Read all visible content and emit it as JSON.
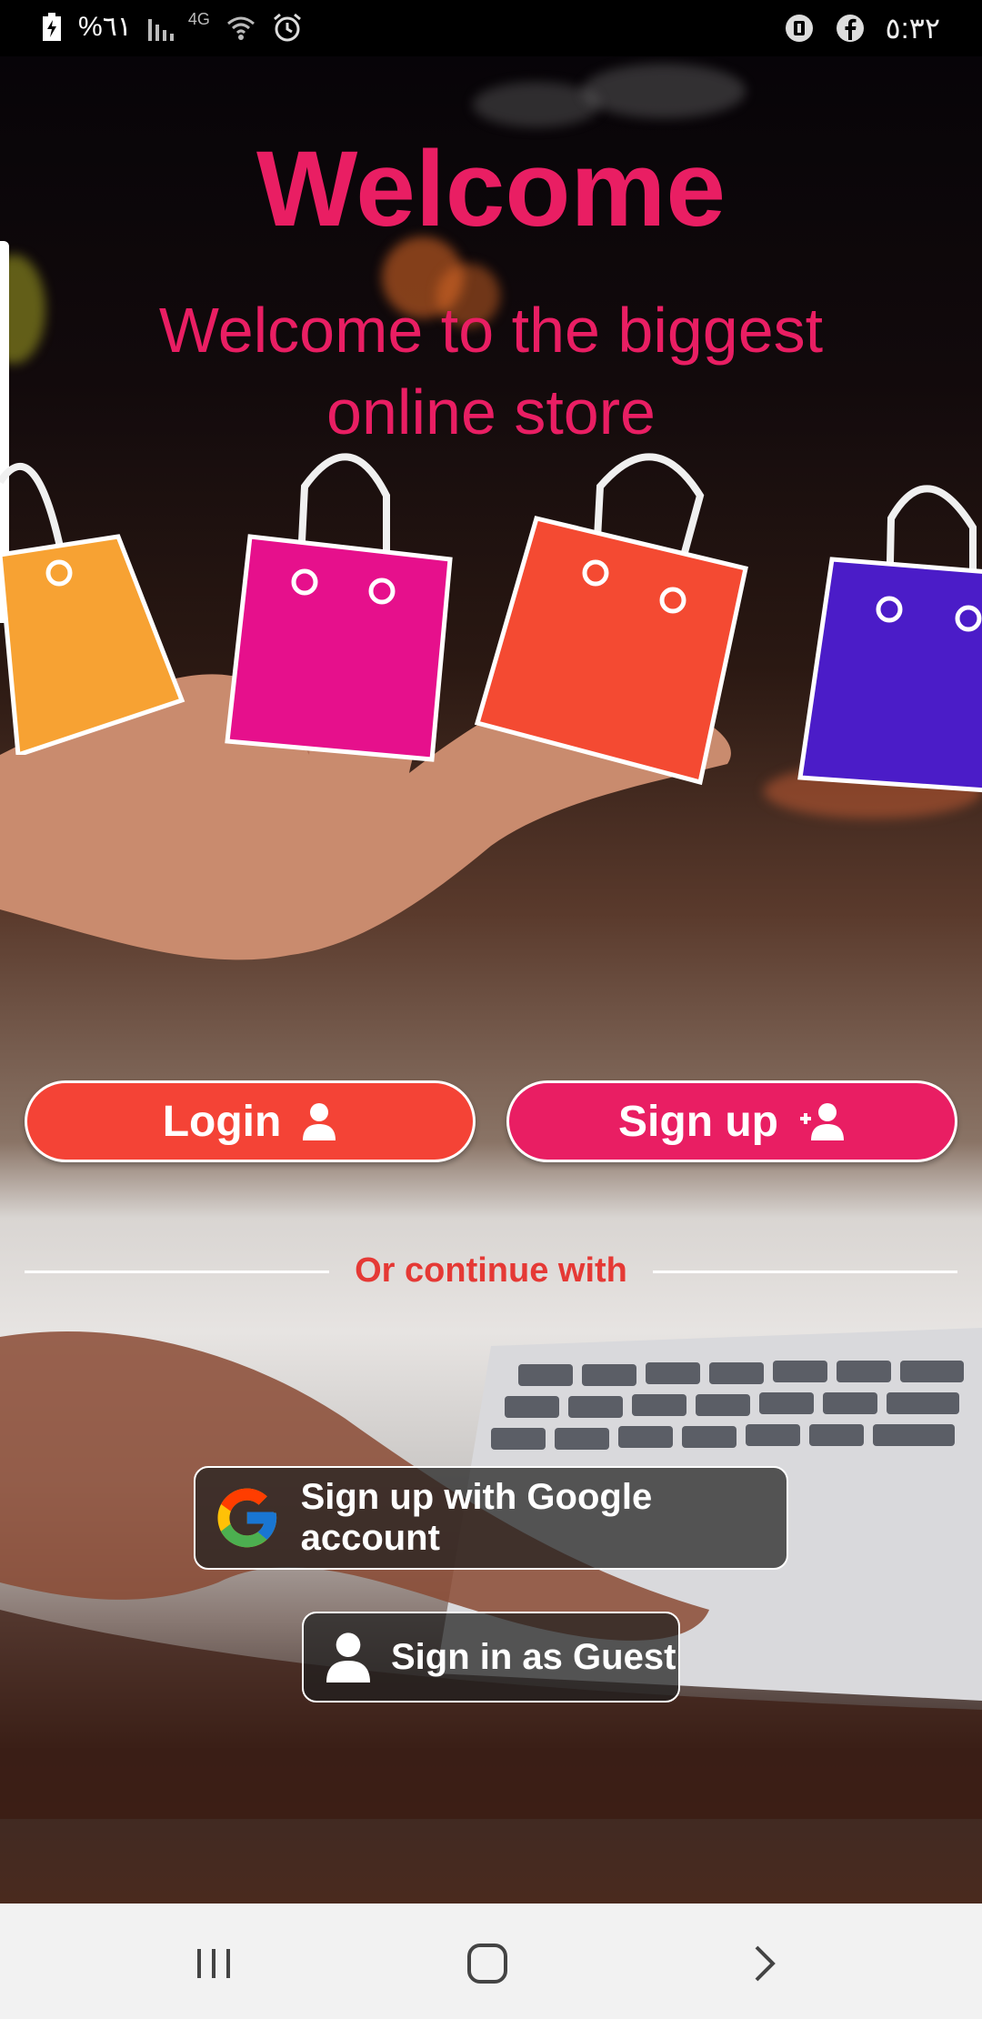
{
  "status_bar": {
    "battery_text": "%٦١",
    "network": "4G",
    "time": "٥:٣٢",
    "icons": [
      "battery-icon",
      "signal-icon",
      "wifi-icon",
      "alarm-icon",
      "app-notification-icon",
      "facebook-icon"
    ]
  },
  "hero": {
    "title": "Welcome",
    "subtitle": "Welcome to the biggest online store"
  },
  "buttons": {
    "login_label": "Login",
    "signup_label": "Sign up",
    "login_color": "#f44336",
    "signup_color": "#e91e63"
  },
  "divider": {
    "text": "Or continue with"
  },
  "social": {
    "google_label": "Sign up with Google account",
    "guest_label": "Sign in as Guest"
  },
  "navbar": {
    "items": [
      "recent-apps-icon",
      "home-icon",
      "back-icon"
    ]
  }
}
